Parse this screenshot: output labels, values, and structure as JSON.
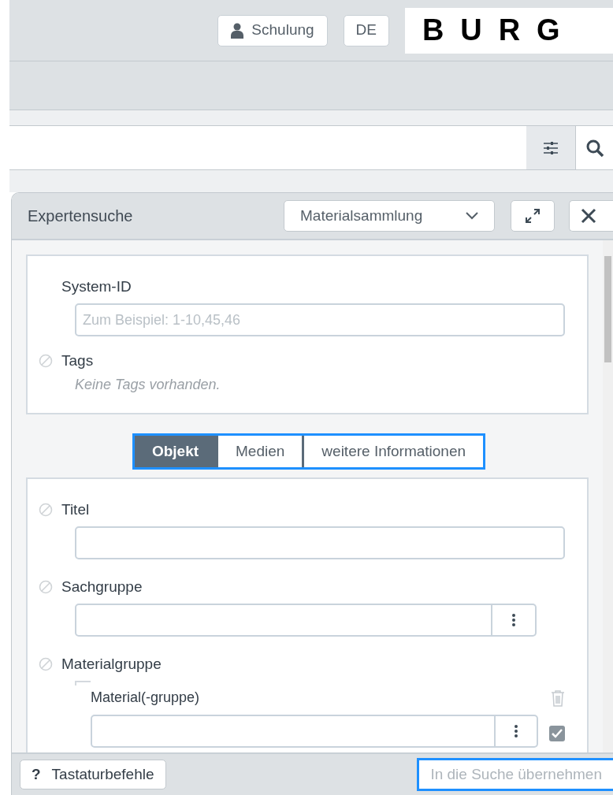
{
  "header": {
    "user_button": "Schulung",
    "language_button": "DE",
    "logo": "BURG"
  },
  "panel": {
    "title": "Expertensuche",
    "collection_select": "Materialsammlung",
    "general_fields": [
      {
        "label": "System-ID",
        "kind": "text",
        "placeholder": "Zum Beispiel: 1-10,45,46",
        "clearable": false
      },
      {
        "label": "Tags",
        "kind": "tags",
        "note": "Keine Tags vorhanden.",
        "clearable": true
      }
    ],
    "tabs": [
      {
        "label": "Objekt",
        "selected": true
      },
      {
        "label": "Medien",
        "selected": false
      },
      {
        "label": "weitere Informationen",
        "selected": false
      }
    ],
    "fields": [
      {
        "label": "Titel",
        "kind": "text",
        "clearable": true
      },
      {
        "label": "Sachgruppe",
        "kind": "picker",
        "clearable": true
      },
      {
        "label": "Materialgruppe",
        "kind": "group",
        "clearable": true,
        "sub_label": "Material(-gruppe)",
        "checked": true
      }
    ]
  },
  "footer": {
    "help_key": "?",
    "help_button": "Tastaturbefehle",
    "apply_button": "In die Suche übernehmen",
    "apply_disabled": true
  }
}
